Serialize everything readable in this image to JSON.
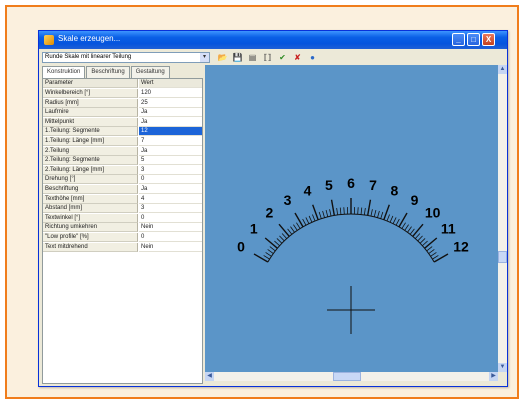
{
  "window": {
    "title": "Skale erzeugen...",
    "buttons": {
      "minimize": "_",
      "maximize": "□",
      "close": "X"
    }
  },
  "scale_type": "Runde Skale mit linearer Teilung",
  "select_arrow": "▾",
  "toolbar": [
    {
      "icon": "open-folder-icon",
      "glyph": "📂",
      "color": "#c89a2a"
    },
    {
      "icon": "save-icon",
      "glyph": "💾",
      "color": "#3c4a7a"
    },
    {
      "icon": "print-icon",
      "glyph": "▤",
      "color": "#444444"
    },
    {
      "icon": "preview-icon",
      "glyph": "⟦⟧",
      "color": "#444444"
    },
    {
      "icon": "check-icon",
      "glyph": "✔",
      "color": "#2e8a22"
    },
    {
      "icon": "cancel-icon",
      "glyph": "✘",
      "color": "#c81c1c"
    },
    {
      "icon": "help-icon",
      "glyph": "●",
      "color": "#2a68c8"
    }
  ],
  "tabs": [
    "Konstruktion",
    "Beschriftung",
    "Gestaltung"
  ],
  "grid": {
    "header": {
      "name": "Parameter",
      "value": "Wert"
    },
    "rows": [
      {
        "name": "Winkelbereich [°]",
        "value": "120"
      },
      {
        "name": "Radius [mm]",
        "value": "25"
      },
      {
        "name": "Laufrnire",
        "value": "Ja"
      },
      {
        "name": "Mittelpunkt",
        "value": "Ja"
      },
      {
        "name": "1.Teilung: Segmente",
        "value": "12",
        "selected": true
      },
      {
        "name": "1.Teilung: Länge [mm]",
        "value": "7"
      },
      {
        "name": "2.Teilung",
        "value": "Ja"
      },
      {
        "name": "2.Teilung: Segmente",
        "value": "5"
      },
      {
        "name": "2.Teilung: Länge [mm]",
        "value": "3"
      },
      {
        "name": "Drehung [°]",
        "value": "0"
      },
      {
        "name": "Beschriftung",
        "value": "Ja"
      },
      {
        "name": "Texthöhe [mm]",
        "value": "4"
      },
      {
        "name": "Abstand [mm]",
        "value": "3"
      },
      {
        "name": "Textwinkel [°]",
        "value": "0"
      },
      {
        "name": "Richtung umkehren",
        "value": "Nein"
      },
      {
        "name": "\"Low profile\" [%]",
        "value": "0"
      },
      {
        "name": "Text mitdrehend",
        "value": "Nein"
      }
    ]
  },
  "scale": {
    "labels": [
      "0",
      "1",
      "2",
      "3",
      "4",
      "5",
      "6",
      "7",
      "8",
      "9",
      "10",
      "11",
      "12"
    ],
    "angle_range_deg": 120,
    "major_divisions": 12,
    "minor_per_major": 5
  },
  "scroll_arrows": {
    "up": "▲",
    "down": "▼",
    "left": "◀",
    "right": "▶"
  },
  "colors": {
    "canvas": "#5b95c8",
    "title_bar": "#0a5fe6",
    "frame": "#f07d1c",
    "selection": "#1c64d8"
  }
}
